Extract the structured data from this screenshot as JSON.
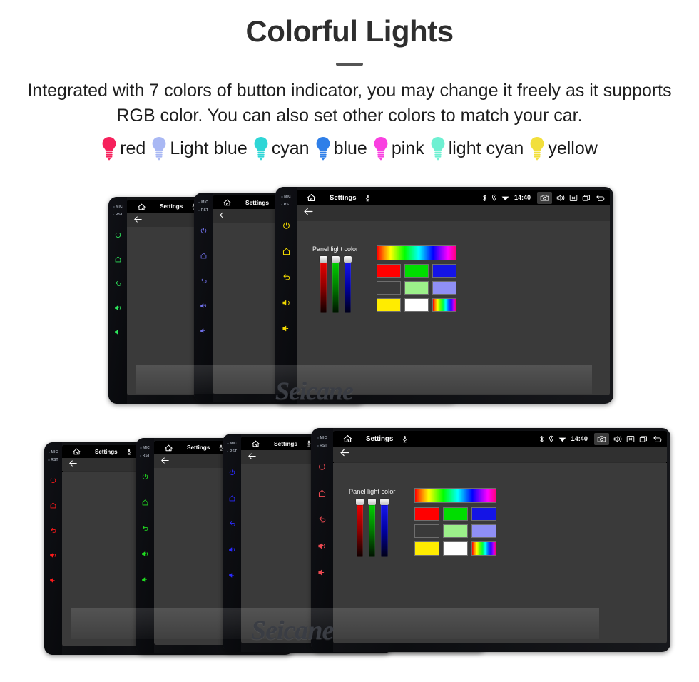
{
  "hero": {
    "title": "Colorful Lights",
    "subtitle": "Integrated with 7 colors of button indicator, you may change it freely as it supports RGB color. You can also set other colors to match your car."
  },
  "legend": {
    "items": [
      {
        "label": "red",
        "color": "#f6215c",
        "icon": "bulb-icon"
      },
      {
        "label": "Light blue",
        "color": "#a9b8f4",
        "icon": "bulb-icon"
      },
      {
        "label": "cyan",
        "color": "#2fd6d6",
        "icon": "bulb-icon"
      },
      {
        "label": "blue",
        "color": "#2f7fe8",
        "icon": "bulb-icon"
      },
      {
        "label": "pink",
        "color": "#f940e0",
        "icon": "bulb-icon"
      },
      {
        "label": "light cyan",
        "color": "#6ff0d2",
        "icon": "bulb-icon"
      },
      {
        "label": "yellow",
        "color": "#f2df3c",
        "icon": "bulb-icon"
      }
    ]
  },
  "device": {
    "side_panel": {
      "mic_label": "MIC",
      "rst_label": "RST",
      "keys": [
        "power-icon",
        "home-icon",
        "back-icon",
        "volume-up-icon",
        "volume-down-icon"
      ]
    },
    "status_bar": {
      "home_icon": "home-icon",
      "title": "Settings",
      "mic_icon": "microphone-icon",
      "bluetooth_icon": "bluetooth-icon",
      "location_icon": "location-pin-icon",
      "wifi_icon": "wifi-icon",
      "clock": "14:40",
      "camera_icon": "camera-icon",
      "volume_icon": "speaker-icon",
      "close_icon": "close-box-icon",
      "recents_icon": "recents-icon",
      "back_icon": "back-arrow-icon"
    },
    "action_bar": {
      "back_icon": "back-arrow-icon"
    },
    "panel": {
      "caption": "Panel light color",
      "sliders": [
        {
          "name": "red-slider",
          "value": 100
        },
        {
          "name": "green-slider",
          "value": 100
        },
        {
          "name": "blue-slider",
          "value": 100
        }
      ],
      "swatches": [
        {
          "name": "rainbow-gradient-swatch",
          "color": "rainbow"
        },
        {
          "name": "red-swatch",
          "color": "#ff0000"
        },
        {
          "name": "green-swatch",
          "color": "#00dd00"
        },
        {
          "name": "blue-swatch",
          "color": "#1414e6"
        },
        {
          "name": "salmon-swatch",
          "color": "#fa8municipal"
        },
        {
          "name": "light-green-swatch",
          "color": "#9cf08a"
        },
        {
          "name": "periwinkle-swatch",
          "color": "#8f8ff5"
        },
        {
          "name": "yellow-swatch",
          "color": "#ffec00"
        },
        {
          "name": "white-swatch",
          "color": "#ffffff"
        },
        {
          "name": "rainbow-small-swatch",
          "color": "rainbow"
        }
      ]
    }
  },
  "groups": {
    "top": {
      "units": [
        {
          "key_color": "#2ee65c",
          "name": "unit-green"
        },
        {
          "key_color": "#6f6fe8",
          "name": "unit-light-blue"
        },
        {
          "key_color": "#f2d900",
          "name": "unit-yellow"
        }
      ],
      "watermark": "Seicane"
    },
    "bottom": {
      "units": [
        {
          "key_color": "#ff1a1a",
          "name": "unit-red"
        },
        {
          "key_color": "#20dd20",
          "name": "unit-green"
        },
        {
          "key_color": "#2b2bff",
          "name": "unit-blue"
        },
        {
          "key_color": "#ef4a52",
          "name": "unit-salmon-red"
        }
      ],
      "watermark": "Seicane"
    }
  },
  "colors": {
    "page_background": "#ffffff",
    "title": "#2e2e2e",
    "screen_background": "#3a3a3a",
    "status_bar": "#000000",
    "action_bar": "#303030"
  }
}
